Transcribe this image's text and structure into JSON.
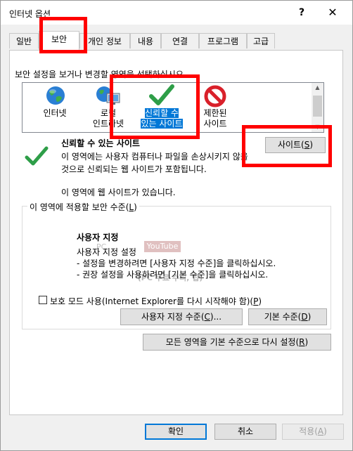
{
  "window": {
    "title": "인터넷 옵션",
    "help_glyph": "?",
    "close_glyph": "✕"
  },
  "tabs": [
    {
      "label": "일반"
    },
    {
      "label": "보안"
    },
    {
      "label": "개인 정보"
    },
    {
      "label": "내용"
    },
    {
      "label": "연결"
    },
    {
      "label": "프로그램"
    },
    {
      "label": "고급"
    }
  ],
  "security": {
    "prompt": "보안 설정을 보거나 변경할 영역을 선택하십시오.",
    "zones": [
      {
        "line1": "인터넷",
        "line2": "",
        "icon": "globe-icon"
      },
      {
        "line1": "로컬",
        "line2": "인트라넷",
        "icon": "intranet-icon"
      },
      {
        "line1": "신뢰할 수",
        "line2": "있는 사이트",
        "icon": "check-icon"
      },
      {
        "line1": "제한된",
        "line2": "사이트",
        "icon": "restricted-icon"
      }
    ],
    "scroll_up": "▲",
    "scroll_down": "▼",
    "selected_zone": {
      "title": "신뢰할 수 있는 사이트",
      "desc": "이 영역에는 사용자 컴퓨터나 파일을 손상시키지 않을 것으로 신뢰되는 웹 사이트가 포함됩니다.",
      "sites_note": "이 영역에 웹 사이트가 있습니다."
    },
    "sites_button": {
      "text": "사이트(",
      "key": "S",
      "tail": ")"
    },
    "level_group": {
      "legend_text": "이 영역에 적용할 보안 수준(",
      "legend_key": "L",
      "legend_tail": ")",
      "custom_title": "사용자 지정",
      "custom_lines": [
        "사용자 지정 설정",
        "- 설정을 변경하려면 [사용자 지정 수준]을 클릭하십시오.",
        "- 권장 설정을 사용하려면 [기본 수준]을 클릭하십시오."
      ]
    },
    "protected_mode": {
      "label_text": "보호 모드 사용(Internet Explorer를 다시 시작해야 함)(",
      "label_key": "P",
      "label_tail": ")",
      "checked": false
    },
    "custom_level_button": {
      "text": "사용자 지정 수준(",
      "key": "C",
      "tail": ")..."
    },
    "default_level_button": {
      "text": "기본 수준(",
      "key": "D",
      "tail": ")"
    },
    "reset_all_button": {
      "text": "모든 영역을 기본 수준으로 다시 설정(",
      "key": "R",
      "tail": ")"
    }
  },
  "watermark": {
    "brand": "YouTube",
    "caption": "(PC 무료 수리, 팁)"
  },
  "footer": {
    "ok": "확인",
    "cancel": "취소",
    "apply_text": "적용(",
    "apply_key": "A",
    "apply_tail": ")"
  },
  "colors": {
    "highlight": "#ff0000",
    "selection": "#0078d7",
    "check_green": "#2e9e48",
    "restricted_red": "#d9202a"
  }
}
